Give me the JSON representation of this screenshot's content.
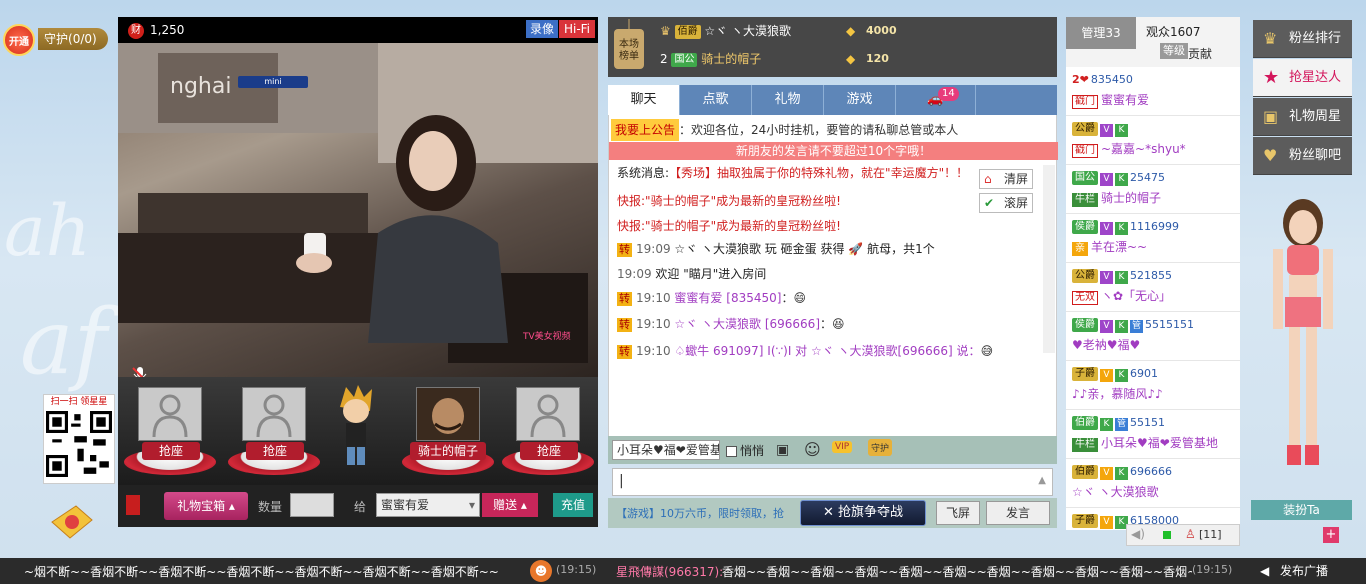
{
  "left": {
    "open_label": "开通",
    "guard_label": "守护",
    "guard_count": "(0/0)",
    "qr_caption": "扫一扫 领星星"
  },
  "video": {
    "coin_icon": "财",
    "coin_count": "1,250",
    "record_label": "录像",
    "hifi_label": "Hi-Fi",
    "logo_text": "TV美女视频",
    "scene_text": "nghai"
  },
  "seats": [
    {
      "label": "抢座"
    },
    {
      "label": "抢座"
    },
    {
      "label": "骑士的帽子"
    },
    {
      "label": "抢座"
    }
  ],
  "giftbar": {
    "giftbox_label": "礼物宝箱",
    "qty_label": "数量",
    "to_label": "给",
    "recipient": "蜜蜜有爱",
    "send_label": "赠送",
    "recharge_label": "充值"
  },
  "rankboard": {
    "title": "本场榜单",
    "rows": [
      {
        "rank": "",
        "level": "佰爵",
        "name": "☆ヾ ヽ大漠狼歌",
        "score": "4000"
      },
      {
        "rank": "2",
        "level": "国公",
        "name": "骑士的帽子",
        "score": "120"
      }
    ],
    "mini_label": "mini"
  },
  "tabs": [
    "聊天",
    "点歌",
    "礼物",
    "游戏"
  ],
  "car_badge": "14",
  "chat": {
    "announce_tag": "我要上公告",
    "announce_text": "：欢迎各位，24小时挂机，要管的请私聊总管或本人",
    "notice": "新朋友的发言请不要超过10个字哦！",
    "clear_label": "清屏",
    "scroll_label": "滚屏",
    "sys_label": "系统消息:",
    "sys_text": "【秀场】抽取独属于你的特殊礼物，就在\"幸运魔方\"！！",
    "flash1_prefix": "快报:",
    "flash1_text": "\"骑士的帽子\"成为最新的皇冠粉丝啦!",
    "flash2_prefix": "快报:",
    "flash2_text": "\"骑士的帽子\"成为最新的皇冠粉丝啦!",
    "m1_time": "19:09",
    "m1_text": "☆ヾ ヽ大漠狼歌 玩 砸金蛋 获得",
    "m1_tail": "航母，共1个",
    "m2_time": "19:09",
    "m2_text": "欢迎 \"瞄月\"进入房间",
    "m3_time": "19:10",
    "m3_name": "蜜蜜有爱",
    "m3_id": "[835450]",
    "m3_colon": "：",
    "m4_time": "19:10",
    "m4_name": "☆ヾ ヽ大漠狼歌",
    "m4_id": "[696666]",
    "m4_colon": "：",
    "m5_time": "19:10",
    "m5_text": "♤蠍牛 691097] I(∵)I 对 ☆ヾ ヽ大漠狼歌[696666] 说：",
    "zhuan": "转"
  },
  "input": {
    "user_pick": "小耳朵♥福❤爱管基",
    "whisper_label": "悄悄",
    "game_ticker": "【游戏】10万六币，限时领取，抢",
    "flag_label": "抢旗争夺战",
    "fly_label": "飞屏",
    "say_label": "发言"
  },
  "userlist": {
    "admin_tab": "管理33",
    "audience_tab": "观众1607",
    "sort_level": "等级",
    "sort_contrib": "贡献",
    "users": [
      {
        "badge": "2❤",
        "num": "835450",
        "role": "戳门",
        "name": "蜜蜜有爱"
      },
      {
        "badge": "公爵",
        "num": "",
        "role": "戳门",
        "name": "~嘉嘉~*shyu*"
      },
      {
        "badge": "国公",
        "num": "25475",
        "role": "牛栏",
        "name": "骑士的帽子"
      },
      {
        "badge": "侯爵",
        "num": "1116999",
        "role": "亲",
        "name": "羊在漂~~"
      },
      {
        "badge": "公爵",
        "num": "521855",
        "role": "无双",
        "name": "ヽ✿「无心」"
      },
      {
        "badge": "侯爵",
        "num": "5515151",
        "role": "",
        "name": "♥老衲♥福♥"
      },
      {
        "badge": "子爵",
        "num": "6901",
        "role": "",
        "name": "♪♪亲，慕随风♪♪"
      },
      {
        "badge": "伯爵",
        "num": "55151",
        "role": "牛栏",
        "name": "小耳朵♥福❤爱管基地"
      },
      {
        "badge": "伯爵",
        "num": "696666",
        "role": "",
        "name": "☆ヾ ヽ大漠狼歌"
      },
      {
        "badge": "子爵",
        "num": "6158000",
        "role": "",
        "name": ""
      }
    ],
    "online": "[11]"
  },
  "rightmenu": [
    "粉丝排行",
    "抢星达人",
    "礼物周星",
    "粉丝聊吧"
  ],
  "dressup_label": "装扮Ta",
  "ticker": {
    "text1": "~烟不断~~香烟不断~~香烟不断~~香烟不断~~香烟不断~~香烟不断~~香烟不断~~",
    "time1": "(19:15)",
    "name2": "星飛傳謀(966317):",
    "text2": "香烟~~香烟~~香烟~~香烟~~香烟~~香烟~~香烟~~香烟~~香烟~~香烟~~香烟~~香烟~~",
    "time2": "(19:15)",
    "broadcast": "发布广播"
  },
  "colors": {
    "accent": "#d3155b",
    "tab_bg": "#5e86b8",
    "notice_bg": "#f47f7f",
    "seat_red": "#b11d2d"
  }
}
